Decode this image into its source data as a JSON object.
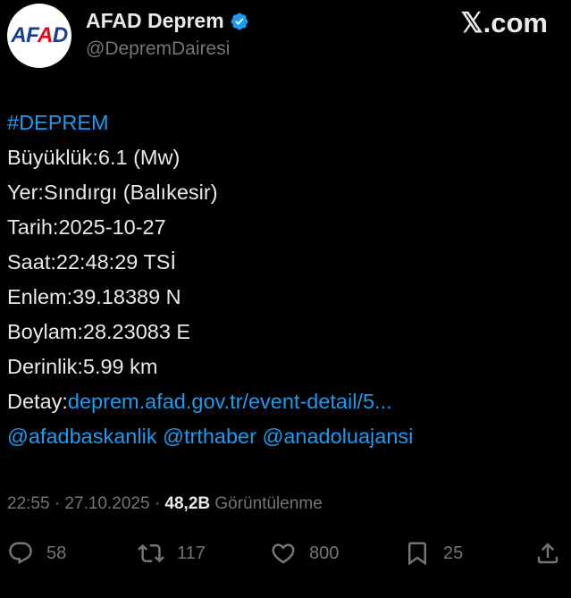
{
  "account": {
    "avatar_text_blue_a": "AF",
    "avatar_text_red": "A",
    "avatar_text_blue_b": "D",
    "name": "AFAD Deprem",
    "handle": "@DepremDairesi",
    "verified_icon": "verified-badge-icon"
  },
  "brand": {
    "site": "𝕏.com"
  },
  "tweet": {
    "hashtag": "#DEPREM",
    "lines": [
      "Büyüklük:6.1 (Mw)",
      "Yer:Sındırgı (Balıkesir)",
      "Tarih:2025-10-27",
      "Saat:22:48:29 TSİ",
      "Enlem:39.18389 N",
      "Boylam:28.23083 E",
      "Derinlik:5.99 km"
    ],
    "detail_label": "Detay:",
    "detail_link": "deprem.afad.gov.tr/event-detail/5...",
    "mentions": [
      "@afadbaskanlik",
      "@trthaber",
      "@anadoluajansi"
    ]
  },
  "meta": {
    "time": "22:55",
    "sep1": "·",
    "date": "27.10.2025",
    "sep2": "·",
    "views": "48,2B",
    "views_label": "Görüntülenme"
  },
  "actions": {
    "replies": "58",
    "reposts": "117",
    "likes": "800",
    "bookmarks": "25"
  },
  "colors": {
    "background": "#000000",
    "text": "#e7e9ea",
    "link": "#1d9bf0",
    "muted": "#71767b",
    "afad_blue": "#1a3f8f",
    "afad_red": "#e30a17"
  }
}
